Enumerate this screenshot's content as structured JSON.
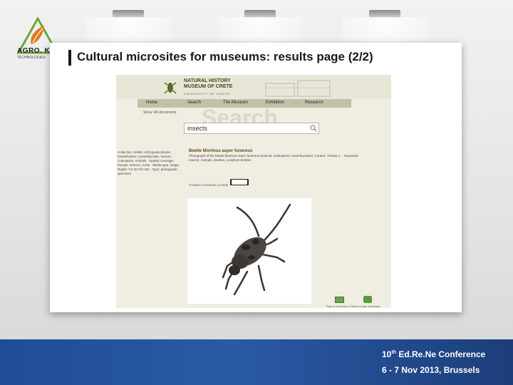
{
  "slide": {
    "title": "Cultural microsites for museums: results page (2/2)",
    "logo": {
      "text": "AGRO. KNOW",
      "sub": "TECHNOLOGIES"
    },
    "footer": {
      "conf_number": "10",
      "conf_suffix": "th",
      "conf_name": "Ed.Re.Ne Conference",
      "dates": "6 - 7 Nov 2013, Brussels"
    }
  },
  "site": {
    "museum_name": "NATURAL HISTORY MUSEUM OF CRETE",
    "museum_sub": "UNIVERSITY OF CRETE",
    "nav": [
      "Home",
      "Search",
      "The Museum",
      "Exhibition",
      "Research"
    ],
    "breadcrumb": "Show: All documents",
    "ghost_text": "Search",
    "search_value": "insects",
    "record": {
      "title": "Beetle Morimus asper funereus",
      "description": "Photograph of the beetle Morimus asper funereus (Insecta, Coleoptera, Cerambycidae). Creator: Trichas A. · Keywords: Insects, Animals, Beetles, Longhorn beetles",
      "meta": "Collection: NHMC Arthropoda photos · Classification: Cerambycidae, Insects, Coleoptera, Animals · Spatial coverage: Europe, Greece, Crete · Media type: image · Rights: CC BY-NC-ND · Type: photograph, specimen",
      "credit": "Creative Commons License"
    },
    "footer_links": "Report a problem | Send us your feedback"
  },
  "colors": {
    "band": "#1f4d95",
    "site_bg": "#f0eee2",
    "nav_bg": "#bfc2a8"
  }
}
